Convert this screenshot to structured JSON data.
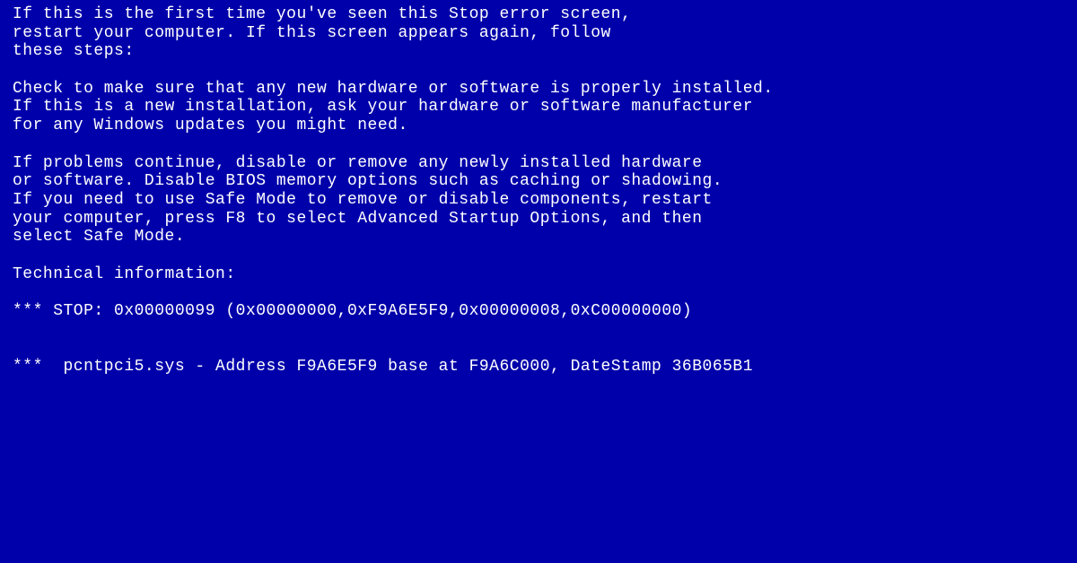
{
  "bsod": {
    "para1_line1": "If this is the first time you've seen this Stop error screen,",
    "para1_line2": "restart your computer. If this screen appears again, follow",
    "para1_line3": "these steps:",
    "para2_line1": "Check to make sure that any new hardware or software is properly installed.",
    "para2_line2": "If this is a new installation, ask your hardware or software manufacturer",
    "para2_line3": "for any Windows updates you might need.",
    "para3_line1": "If problems continue, disable or remove any newly installed hardware",
    "para3_line2": "or software. Disable BIOS memory options such as caching or shadowing.",
    "para3_line3": "If you need to use Safe Mode to remove or disable components, restart",
    "para3_line4": "your computer, press F8 to select Advanced Startup Options, and then",
    "para3_line5": "select Safe Mode.",
    "tech_header": "Technical information:",
    "stop_line": "*** STOP: 0x00000099 (0x00000000,0xF9A6E5F9,0x00000008,0xC00000000)",
    "driver_line": "***  pcntpci5.sys - Address F9A6E5F9 base at F9A6C000, DateStamp 36B065B1"
  }
}
